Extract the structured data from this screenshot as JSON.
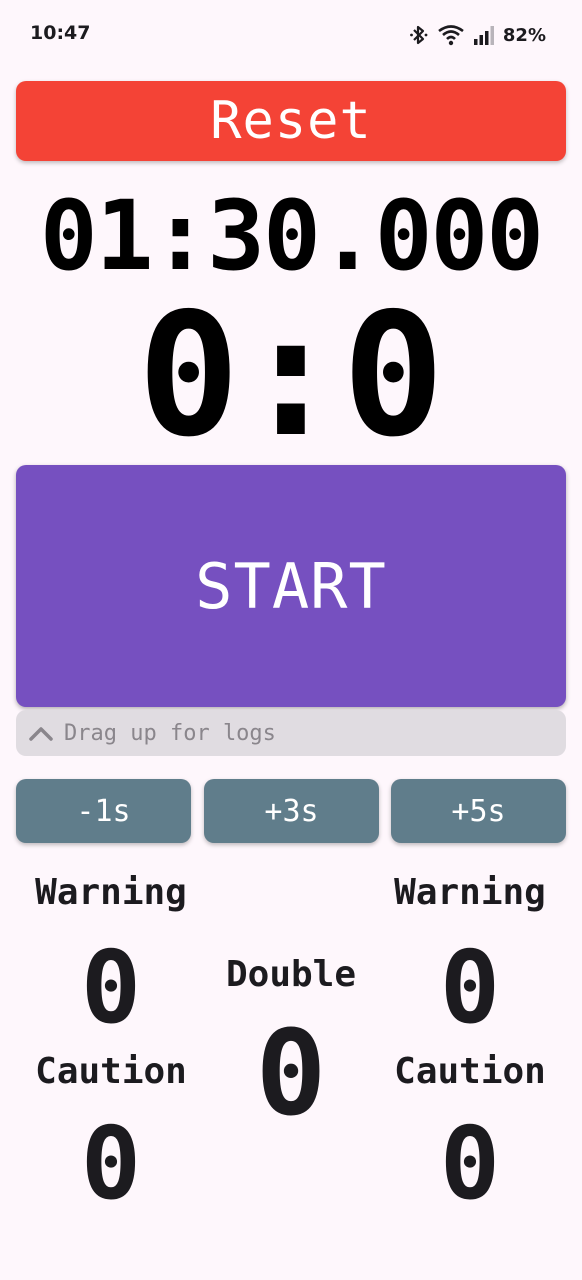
{
  "status_bar": {
    "time": "10:47",
    "battery": "82%",
    "icons": [
      "bluetooth-icon",
      "wifi-icon",
      "signal-icon"
    ]
  },
  "controls": {
    "reset_label": "Reset",
    "start_label": "START",
    "drag_hint": "Drag up for logs",
    "adjust_buttons": [
      "-1s",
      "+3s",
      "+5s"
    ]
  },
  "timer": {
    "display": "01:30.000",
    "score": "0:0"
  },
  "penalties": {
    "left": {
      "warning_label": "Warning",
      "warning_count": "0",
      "caution_label": "Caution",
      "caution_count": "0"
    },
    "center": {
      "double_label": "Double",
      "double_count": "0"
    },
    "right": {
      "warning_label": "Warning",
      "warning_count": "0",
      "caution_label": "Caution",
      "caution_count": "0"
    }
  },
  "colors": {
    "reset": "#f44336",
    "start": "#7650c0",
    "adjust": "#607d8b",
    "drag_bar": "#e0dce1",
    "background": "#fef7fc"
  }
}
